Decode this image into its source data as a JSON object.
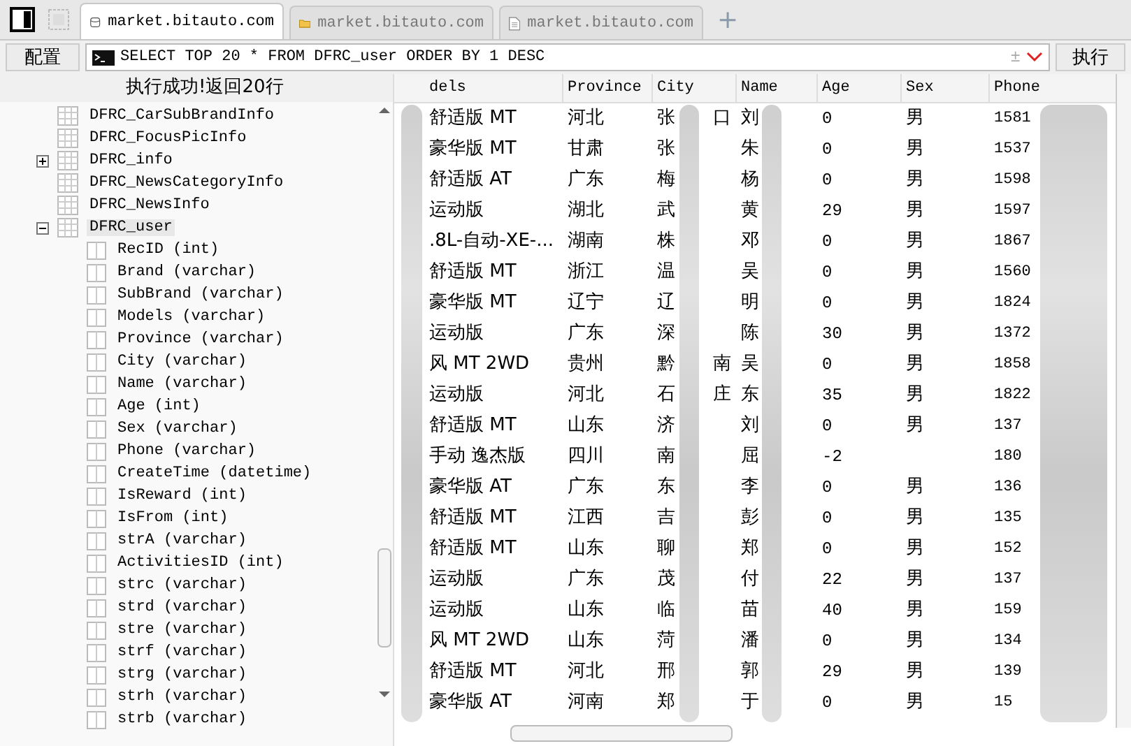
{
  "tabs": [
    {
      "label": "market.bitauto.com",
      "kind": "database",
      "selected": true
    },
    {
      "label": "market.bitauto.com",
      "kind": "folder",
      "selected": false
    },
    {
      "label": "market.bitauto.com",
      "kind": "document",
      "selected": false
    }
  ],
  "new_tab": "+",
  "query_bar": {
    "config_button": "配置",
    "query": "SELECT TOP 20 * FROM DFRC_user ORDER BY 1 DESC",
    "plusminus": "±",
    "run_button": "执行"
  },
  "status": "执行成功!返回20行",
  "tree": {
    "items": [
      {
        "label": "DFRC_CarSubBrandInfo",
        "selected": false
      },
      {
        "label": "DFRC_FocusPicInfo",
        "selected": false
      },
      {
        "label": "DFRC_info",
        "selected": false,
        "expanded": false
      },
      {
        "label": "DFRC_NewsCategoryInfo",
        "selected": false
      },
      {
        "label": "DFRC_NewsInfo",
        "selected": false
      },
      {
        "label": "DFRC_user",
        "selected": true,
        "expanded": true,
        "children": [
          {
            "label": "RecID (int)"
          },
          {
            "label": "Brand (varchar)"
          },
          {
            "label": "SubBrand (varchar)"
          },
          {
            "label": "Models (varchar)"
          },
          {
            "label": "Province (varchar)"
          },
          {
            "label": "City (varchar)"
          },
          {
            "label": "Name (varchar)"
          },
          {
            "label": "Age (int)"
          },
          {
            "label": "Sex (varchar)"
          },
          {
            "label": "Phone (varchar)"
          },
          {
            "label": "CreateTime (datetime)"
          },
          {
            "label": "IsReward (int)"
          },
          {
            "label": "IsFrom (int)"
          },
          {
            "label": "strA (varchar)"
          },
          {
            "label": "ActivitiesID (int)"
          },
          {
            "label": "strc (varchar)"
          },
          {
            "label": "strd (varchar)"
          },
          {
            "label": "stre (varchar)"
          },
          {
            "label": "strf (varchar)"
          },
          {
            "label": "strg (varchar)"
          },
          {
            "label": "strh (varchar)"
          },
          {
            "label": "strb (varchar)"
          }
        ]
      }
    ]
  },
  "table": {
    "columns": [
      "dels",
      "Province",
      "City",
      "Name",
      "Age",
      "Sex",
      "Phone"
    ],
    "rows": [
      {
        "models": "舒适版 MT",
        "province": "河北",
        "city": "张",
        "city_end": "口",
        "name": "刘",
        "age": "0",
        "sex": "男",
        "phone": "1581"
      },
      {
        "models": "豪华版 MT",
        "province": "甘肃",
        "city": "张",
        "name": "朱",
        "age": "0",
        "sex": "男",
        "phone": "1537"
      },
      {
        "models": "舒适版 AT",
        "province": "广东",
        "city": "梅",
        "name": "杨",
        "age": "0",
        "sex": "男",
        "phone": "1598"
      },
      {
        "models": "运动版",
        "province": "湖北",
        "city": "武",
        "name": "黄",
        "age": "29",
        "sex": "男",
        "phone": "1597"
      },
      {
        "models": ".8L-自动-XE-...",
        "province": "湖南",
        "city": "株",
        "name": "邓",
        "age": "0",
        "sex": "男",
        "phone": "1867"
      },
      {
        "models": "舒适版 MT",
        "province": "浙江",
        "city": "温",
        "name": "吴",
        "age": "0",
        "sex": "男",
        "phone": "1560"
      },
      {
        "models": "豪华版 MT",
        "province": "辽宁",
        "city": "辽",
        "name": "明",
        "age": "0",
        "sex": "男",
        "phone": "1824"
      },
      {
        "models": "运动版",
        "province": "广东",
        "city": "深",
        "name": "陈",
        "age": "30",
        "sex": "男",
        "phone": "1372"
      },
      {
        "models": "风 MT 2WD",
        "province": "贵州",
        "city": "黔",
        "city_end": "南",
        "name": "吴",
        "age": "0",
        "sex": "男",
        "phone": "1858"
      },
      {
        "models": "运动版",
        "province": "河北",
        "city": "石",
        "city_end": "庄",
        "name": "东",
        "age": "35",
        "sex": "男",
        "phone": "1822"
      },
      {
        "models": "舒适版 MT",
        "province": "山东",
        "city": "济",
        "name": "刘",
        "age": "0",
        "sex": "男",
        "phone": "137"
      },
      {
        "models": "手动 逸杰版",
        "province": "四川",
        "city": "南",
        "name": "屈",
        "age": "-2",
        "phone": "180"
      },
      {
        "models": "豪华版 AT",
        "province": "广东",
        "city": "东",
        "name": "李",
        "age": "0",
        "sex": "男",
        "phone": "136"
      },
      {
        "models": "舒适版 MT",
        "province": "江西",
        "city": "吉",
        "name": "彭",
        "age": "0",
        "sex": "男",
        "phone": "135"
      },
      {
        "models": "舒适版 MT",
        "province": "山东",
        "city": "聊",
        "name": "郑",
        "age": "0",
        "sex": "男",
        "phone": "152"
      },
      {
        "models": "运动版",
        "province": "广东",
        "city": "茂",
        "name": "付",
        "age": "22",
        "sex": "男",
        "phone": "137"
      },
      {
        "models": "运动版",
        "province": "山东",
        "city": "临",
        "name": "苗",
        "age": "40",
        "sex": "男",
        "phone": "159"
      },
      {
        "models": "风 MT 2WD",
        "province": "山东",
        "city": "菏",
        "name": "潘",
        "age": "0",
        "sex": "男",
        "phone": "134"
      },
      {
        "models": "舒适版 MT",
        "province": "河北",
        "city": "邢",
        "name": "郭",
        "age": "29",
        "sex": "男",
        "phone": "139"
      },
      {
        "models": "豪华版 AT",
        "province": "河南",
        "city": "郑",
        "name": "于",
        "age": "0",
        "sex": "男",
        "phone": "15"
      }
    ]
  }
}
